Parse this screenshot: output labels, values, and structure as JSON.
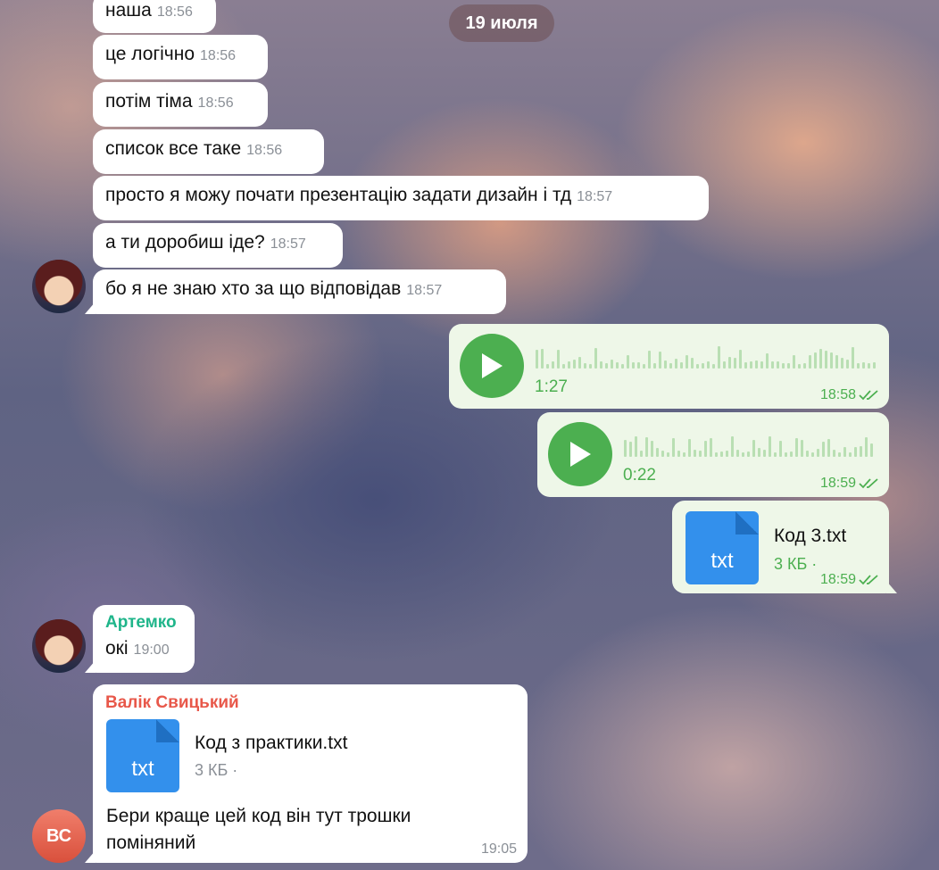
{
  "date_badge": "19 июля",
  "incoming_messages": [
    {
      "text": "наша",
      "time": "18:56"
    },
    {
      "text": "це логічно",
      "time": "18:56"
    },
    {
      "text": "потім тіма",
      "time": "18:56"
    },
    {
      "text": "список все таке",
      "time": "18:56"
    },
    {
      "text": "просто я можу почати презентацію задати дизайн і тд",
      "time": "18:57"
    },
    {
      "text": "а ти доробиш іде?",
      "time": "18:57"
    },
    {
      "text": "бо я не знаю хто за що відповідав",
      "time": "18:57"
    }
  ],
  "outgoing": {
    "voice1": {
      "duration": "1:27",
      "time": "18:58",
      "status_icon": "double-check-icon"
    },
    "voice2": {
      "duration": "0:22",
      "time": "18:59",
      "status_icon": "double-check-icon"
    },
    "file": {
      "ext": "txt",
      "name": "Код 3.txt",
      "size": "3 КБ ·",
      "time": "18:59",
      "status_icon": "double-check-icon"
    }
  },
  "artemko": {
    "sender": "Артемко",
    "text": "окі",
    "time": "19:00",
    "sender_color": "#1fb58a"
  },
  "valik": {
    "sender": "Валік Свицький",
    "sender_color": "#e8584a",
    "file_ext": "txt",
    "file_name": "Код з практики.txt",
    "file_size": "3 КБ ·",
    "text_line1": "Бери краще цей код він тут трошки",
    "text_line2": "поміняний",
    "time": "19:05",
    "avatar_initials": "ВС"
  },
  "colors": {
    "outgoing_bubble": "#eef7e8",
    "accent_green": "#4caf50",
    "file_blue": "#3390ec"
  }
}
